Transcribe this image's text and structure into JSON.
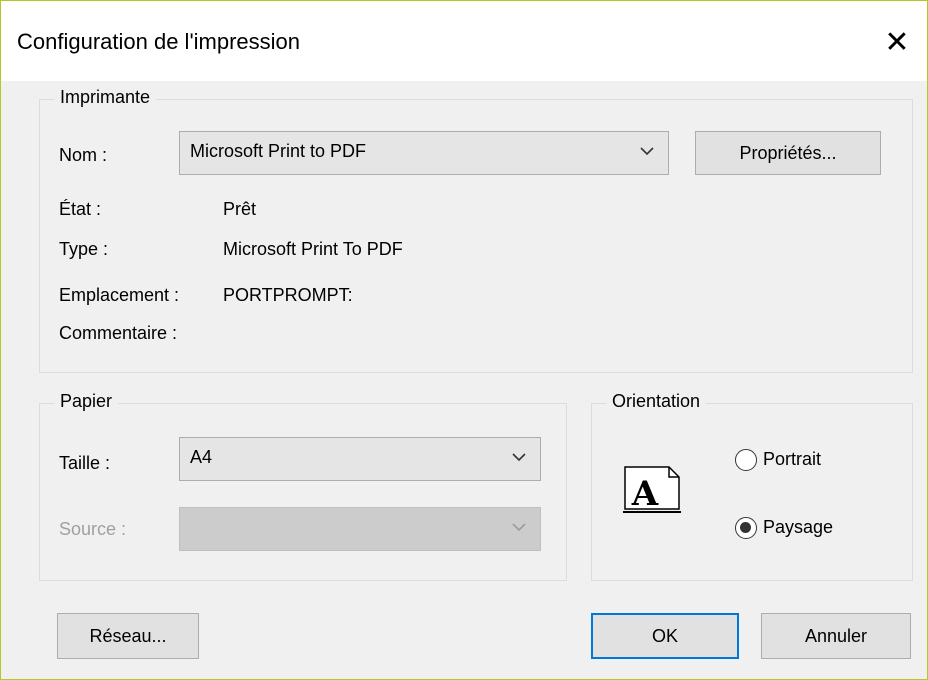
{
  "dialog": {
    "title": "Configuration de l'impression",
    "close_icon": "close-icon"
  },
  "printer": {
    "group_label": "Imprimante",
    "name_label": "Nom :",
    "name_value": "Microsoft Print to PDF",
    "properties_button": "Propriétés...",
    "status_label": "État :",
    "status_value": "Prêt",
    "type_label": "Type :",
    "type_value": "Microsoft Print To PDF",
    "location_label": "Emplacement :",
    "location_value": "PORTPROMPT:",
    "comment_label": "Commentaire :",
    "comment_value": ""
  },
  "paper": {
    "group_label": "Papier",
    "size_label": "Taille :",
    "size_value": "A4",
    "source_label": "Source :",
    "source_value": ""
  },
  "orientation": {
    "group_label": "Orientation",
    "portrait_label": "Portrait",
    "landscape_label": "Paysage",
    "selected": "Paysage",
    "preview_letter": "A"
  },
  "footer": {
    "network_button": "Réseau...",
    "ok_button": "OK",
    "cancel_button": "Annuler"
  },
  "colors": {
    "accent": "#0078d7",
    "window_border": "#b9c431",
    "background": "#f0f0f0"
  }
}
